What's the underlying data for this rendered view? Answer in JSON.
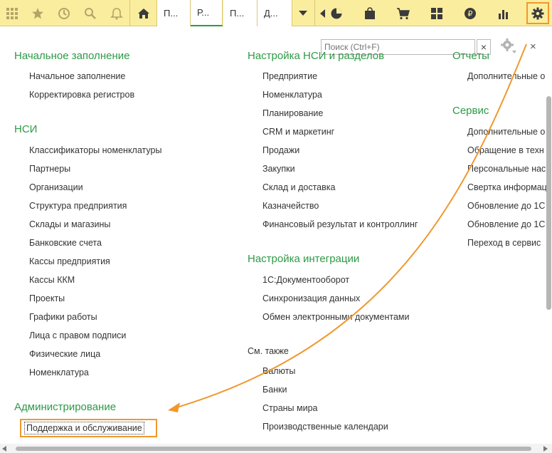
{
  "toolbar": {
    "icons": [
      "apps-grid-icon",
      "star-icon",
      "history-icon",
      "search-icon",
      "bell-icon",
      "home-icon"
    ],
    "tabs": [
      {
        "label": "П..."
      },
      {
        "label": "Р..."
      },
      {
        "label": "П..."
      },
      {
        "label": "Д..."
      }
    ],
    "section_icons": [
      "pie-chart-icon",
      "bag-icon",
      "cart-icon",
      "grid-icon",
      "ruble-icon",
      "bar-chart-icon",
      "gear-icon"
    ]
  },
  "search": {
    "placeholder": "Поиск (Ctrl+F)",
    "clear_label": "×"
  },
  "panel": {
    "close_label": "×"
  },
  "col1": {
    "sections": [
      {
        "title": "Начальное заполнение",
        "items": [
          "Начальное заполнение",
          "Корректировка регистров"
        ]
      },
      {
        "title": "НСИ",
        "items": [
          "Классификаторы номенклатуры",
          "Партнеры",
          "Организации",
          "Структура предприятия",
          "Склады и магазины",
          "Банковские счета",
          "Кассы предприятия",
          "Кассы ККМ",
          "Проекты",
          "Графики работы",
          "Лица с правом подписи",
          "Физические лица",
          "Номенклатура"
        ]
      },
      {
        "title": "Администрирование",
        "items": [
          "Поддержка и обслуживание"
        ]
      }
    ]
  },
  "col2": {
    "sections": [
      {
        "title": "Настройка НСИ и разделов",
        "items": [
          "Предприятие",
          "Номенклатура",
          "Планирование",
          "CRM и маркетинг",
          "Продажи",
          "Закупки",
          "Склад и доставка",
          "Казначейство",
          "Финансовый результат и контроллинг"
        ]
      },
      {
        "title": "Настройка интеграции",
        "items": [
          "1С:Документооборот",
          "Синхронизация данных",
          "Обмен электронными документами"
        ]
      }
    ],
    "see_also": {
      "title": "См. также",
      "items": [
        "Валюты",
        "Банки",
        "Страны мира",
        "Производственные календари"
      ]
    }
  },
  "col3": {
    "sections": [
      {
        "title": "Отчеты",
        "items": [
          "Дополнительные о"
        ]
      },
      {
        "title": "Сервис",
        "items": [
          "Дополнительные о",
          "Обращение в техн",
          "Персональные нас",
          "Свертка информац",
          "Обновление до 1С",
          "Обновление до 1С",
          "Переход в сервис"
        ]
      }
    ]
  },
  "colors": {
    "toolbar_bg": "#fbed9e",
    "section_title": "#2d9a46",
    "highlight": "#f0982e",
    "active_tab_underline": "#2d9a46"
  }
}
